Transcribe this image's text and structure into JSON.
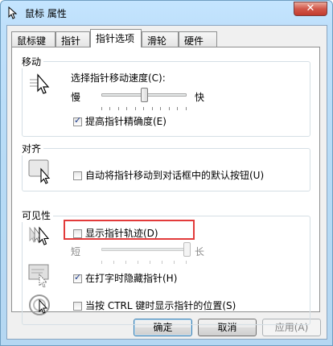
{
  "window": {
    "title": "鼠标 属性",
    "close_symbol": "✕"
  },
  "tabs": [
    "鼠标键",
    "指针",
    "指针选项",
    "滑轮",
    "硬件"
  ],
  "motion": {
    "group_title": "移动",
    "speed_label": "选择指针移动速度(C):",
    "slow": "慢",
    "fast": "快",
    "speed_value_fraction": 0.5,
    "precision_label": "提高指针精确度(E)",
    "precision_checked": true
  },
  "snap": {
    "group_title": "对齐",
    "snap_label": "自动将指针移动到对话框中的默认按钮(U)",
    "snap_checked": false
  },
  "visibility": {
    "group_title": "可见性",
    "trails_label": "显示指针轨迹(D)",
    "trails_checked": false,
    "short": "短",
    "long": "长",
    "trails_value_fraction": 1.0,
    "hide_label": "在打字时隐藏指针(H)",
    "hide_checked": true,
    "ctrl_label": "当按 CTRL 键时显示指针的位置(S)",
    "ctrl_checked": false
  },
  "buttons": {
    "ok": "确定",
    "cancel": "取消",
    "apply": "应用(A)"
  },
  "colors": {
    "highlight": "#e23b3b",
    "title_bar": "#c4e5ff"
  }
}
